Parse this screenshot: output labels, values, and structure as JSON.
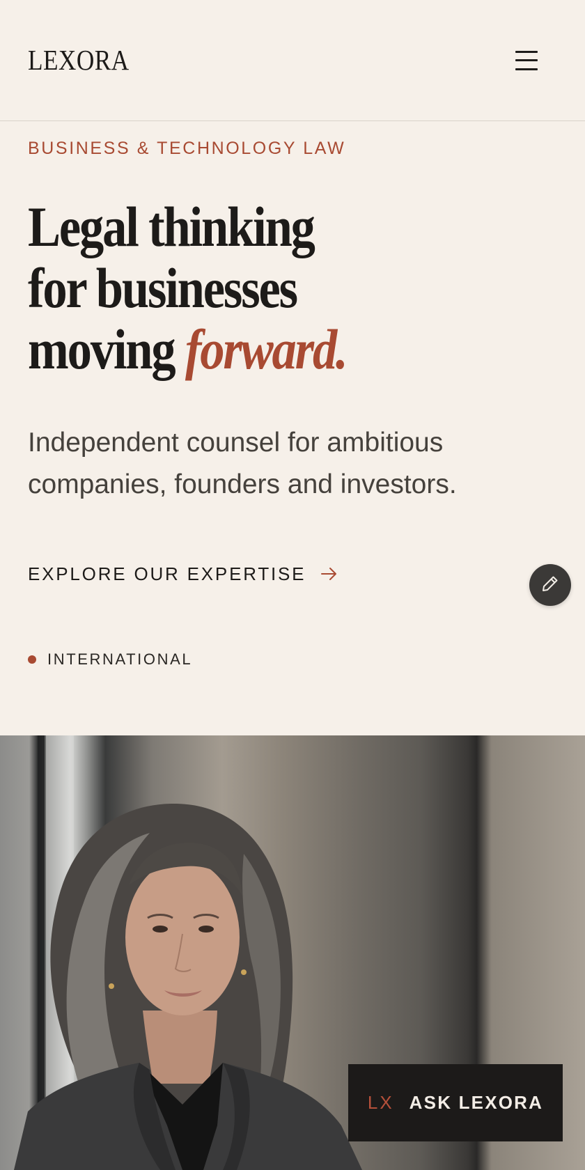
{
  "brand": {
    "logo_text": "LEXORA"
  },
  "header": {
    "menu_icon": "hamburger-menu-icon"
  },
  "hero": {
    "eyebrow": "BUSINESS & TECHNOLOGY LAW",
    "headline_line1": "Legal thinking",
    "headline_line2": "for businesses",
    "headline_line3_plain": "moving",
    "headline_line3_accent": "forward.",
    "subhead": "Independent counsel for ambitious companies, founders and investors.",
    "cta_label": "EXPLORE OUR EXPERTISE",
    "cta_icon": "arrow-right-icon",
    "badge_label": "INTERNATIONAL"
  },
  "fab": {
    "icon": "pencil-icon"
  },
  "photo": {
    "subject": "portrait-photo"
  },
  "ask": {
    "prefix": "LX",
    "label": "ASK LEXORA"
  },
  "colors": {
    "background": "#f6f0e9",
    "accent": "#a84a32",
    "text": "#1d1b19",
    "muted_text": "#45413c",
    "dark_button": "#1c1a19"
  }
}
